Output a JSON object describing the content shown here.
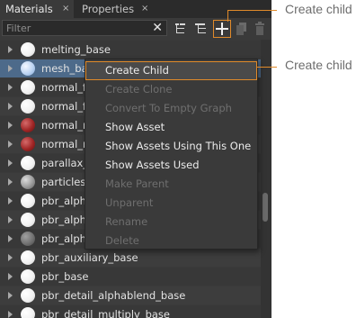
{
  "tabs": [
    {
      "label": "Materials",
      "close": "×"
    },
    {
      "label": "Properties",
      "close": "×"
    }
  ],
  "filter": {
    "placeholder": "Filter",
    "clear": "✕"
  },
  "toolbar": {
    "buttons": [
      {
        "name": "hierarchy-expand-icon"
      },
      {
        "name": "hierarchy-collapse-icon"
      },
      {
        "name": "create-child-icon"
      },
      {
        "name": "copy-icon"
      },
      {
        "name": "delete-icon"
      }
    ]
  },
  "materials": [
    {
      "label": "melting_base",
      "ball": "white"
    },
    {
      "label": "mesh_base",
      "ball": "blue"
    },
    {
      "label": "normal_fr",
      "ball": "white"
    },
    {
      "label": "normal_fr",
      "ball": "white"
    },
    {
      "label": "normal_m",
      "ball": "red"
    },
    {
      "label": "normal_m",
      "ball": "red"
    },
    {
      "label": "parallax_i",
      "ball": "white"
    },
    {
      "label": "particles_l",
      "ball": "gray"
    },
    {
      "label": "pbr_alpha",
      "ball": "white"
    },
    {
      "label": "pbr_alpha",
      "ball": "white"
    },
    {
      "label": "pbr_alpha",
      "ball": "darkgray"
    },
    {
      "label": "pbr_auxiliary_base",
      "ball": "white"
    },
    {
      "label": "pbr_base",
      "ball": "white"
    },
    {
      "label": "pbr_detail_alphablend_base",
      "ball": "white"
    },
    {
      "label": "pbr_detail_multiply_base",
      "ball": "white"
    }
  ],
  "context_menu": {
    "items": [
      {
        "label": "Create Child",
        "enabled": true
      },
      {
        "label": "Create Clone",
        "enabled": false
      },
      {
        "label": "Convert To Empty Graph",
        "enabled": false
      },
      {
        "label": "Show Asset",
        "enabled": true
      },
      {
        "label": "Show Assets Using This One",
        "enabled": true
      },
      {
        "label": "Show Assets Used",
        "enabled": true
      },
      {
        "label": "Make Parent",
        "enabled": false
      },
      {
        "label": "Unparent",
        "enabled": false
      },
      {
        "label": "Rename",
        "enabled": false
      },
      {
        "label": "Delete",
        "enabled": false
      }
    ]
  },
  "callouts": {
    "toolbar": "Create child",
    "menu": "Create child",
    "color": "#e08a2a"
  },
  "colors": {
    "selection": "#4d6a8a",
    "panel": "#3a3a3a"
  }
}
